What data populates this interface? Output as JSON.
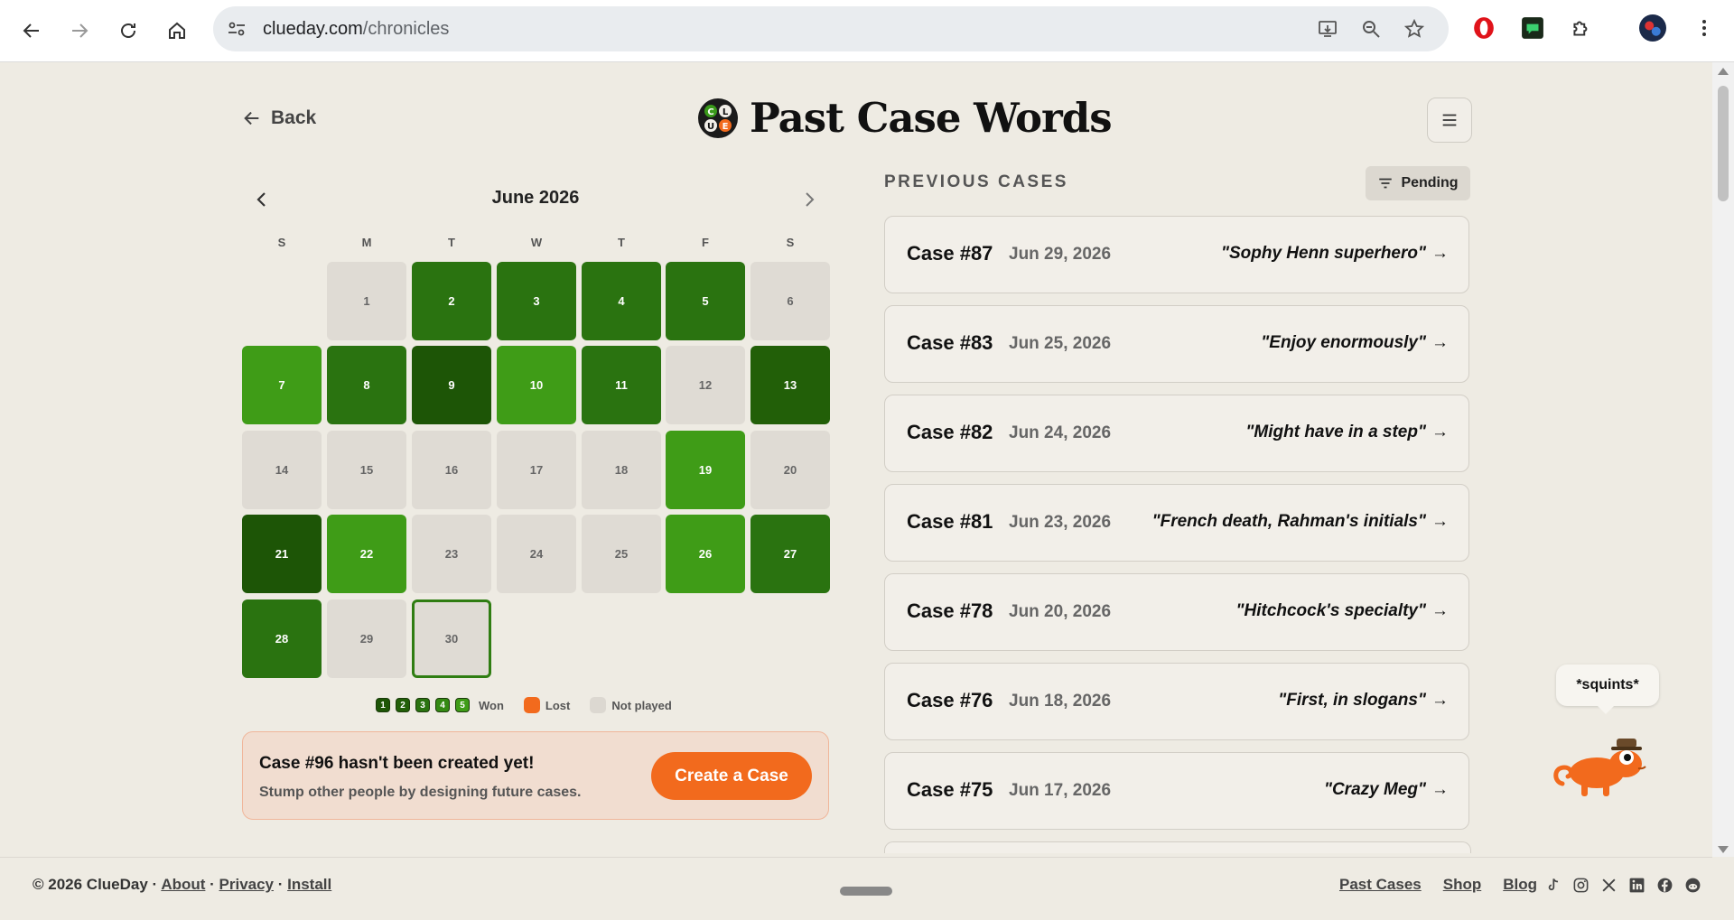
{
  "browser": {
    "url_host": "clueday.com",
    "url_path": "/chronicles"
  },
  "header": {
    "back_label": "Back",
    "title": "Past Case Words",
    "logo_letters": "CLUE"
  },
  "calendar": {
    "month_label": "June 2026",
    "weekdays": [
      "S",
      "M",
      "T",
      "W",
      "T",
      "F",
      "S"
    ],
    "days": [
      {
        "day": "1",
        "status": "not-played"
      },
      {
        "day": "2",
        "status": "won",
        "guesses": 3
      },
      {
        "day": "3",
        "status": "won",
        "guesses": 3
      },
      {
        "day": "4",
        "status": "won",
        "guesses": 3
      },
      {
        "day": "5",
        "status": "won",
        "guesses": 3
      },
      {
        "day": "6",
        "status": "not-played"
      },
      {
        "day": "7",
        "status": "won",
        "guesses": 5
      },
      {
        "day": "8",
        "status": "won",
        "guesses": 3
      },
      {
        "day": "9",
        "status": "won",
        "guesses": 1
      },
      {
        "day": "10",
        "status": "won",
        "guesses": 5
      },
      {
        "day": "11",
        "status": "won",
        "guesses": 3
      },
      {
        "day": "12",
        "status": "not-played"
      },
      {
        "day": "13",
        "status": "won",
        "guesses": 2
      },
      {
        "day": "14",
        "status": "not-played"
      },
      {
        "day": "15",
        "status": "not-played"
      },
      {
        "day": "16",
        "status": "not-played"
      },
      {
        "day": "17",
        "status": "not-played"
      },
      {
        "day": "18",
        "status": "not-played"
      },
      {
        "day": "19",
        "status": "won",
        "guesses": 5
      },
      {
        "day": "20",
        "status": "not-played"
      },
      {
        "day": "21",
        "status": "won",
        "guesses": 1
      },
      {
        "day": "22",
        "status": "won",
        "guesses": 5
      },
      {
        "day": "23",
        "status": "not-played"
      },
      {
        "day": "24",
        "status": "not-played"
      },
      {
        "day": "25",
        "status": "not-played"
      },
      {
        "day": "26",
        "status": "won",
        "guesses": 5
      },
      {
        "day": "27",
        "status": "won",
        "guesses": 3
      },
      {
        "day": "28",
        "status": "won",
        "guesses": 3
      },
      {
        "day": "29",
        "status": "not-played"
      },
      {
        "day": "30",
        "status": "today"
      }
    ],
    "legend": {
      "won_levels": [
        "1",
        "2",
        "3",
        "4",
        "5"
      ],
      "won_label": "Won",
      "lost_label": "Lost",
      "not_played_label": "Not played"
    },
    "colors": {
      "1": "#1d5506",
      "2": "#225f08",
      "3": "#2a7310",
      "4": "#348a13",
      "5": "#3f9c17",
      "lost": "#f26a1d",
      "not_played": "#dfdbd4"
    }
  },
  "create_case": {
    "title": "Case #96 hasn't been created yet!",
    "subtitle": "Stump other people by designing future cases.",
    "button_label": "Create a Case"
  },
  "previous_cases": {
    "heading": "PREVIOUS CASES",
    "filter_label": "Pending",
    "items": [
      {
        "number": "Case #87",
        "date": "Jun 29, 2026",
        "clue": "\"Sophy Henn superhero\""
      },
      {
        "number": "Case #83",
        "date": "Jun 25, 2026",
        "clue": "\"Enjoy enormously\""
      },
      {
        "number": "Case #82",
        "date": "Jun 24, 2026",
        "clue": "\"Might have in a step\""
      },
      {
        "number": "Case #81",
        "date": "Jun 23, 2026",
        "clue": "\"French death, Rahman's initials\""
      },
      {
        "number": "Case #78",
        "date": "Jun 20, 2026",
        "clue": "\"Hitchcock's specialty\""
      },
      {
        "number": "Case #76",
        "date": "Jun 18, 2026",
        "clue": "\"First, in slogans\""
      },
      {
        "number": "Case #75",
        "date": "Jun 17, 2026",
        "clue": "\"Crazy Meg\""
      }
    ],
    "arrow": "→"
  },
  "mascot": {
    "speech": "*squints*"
  },
  "footer": {
    "copyright": "© 2026 ClueDay",
    "separator": " · ",
    "links_left": [
      "About",
      "Privacy",
      "Install"
    ],
    "links_right": [
      "Past Cases",
      "Shop",
      "Blog"
    ],
    "social": [
      "tiktok-icon",
      "instagram-icon",
      "x-icon",
      "linkedin-icon",
      "facebook-icon",
      "reddit-icon"
    ]
  }
}
